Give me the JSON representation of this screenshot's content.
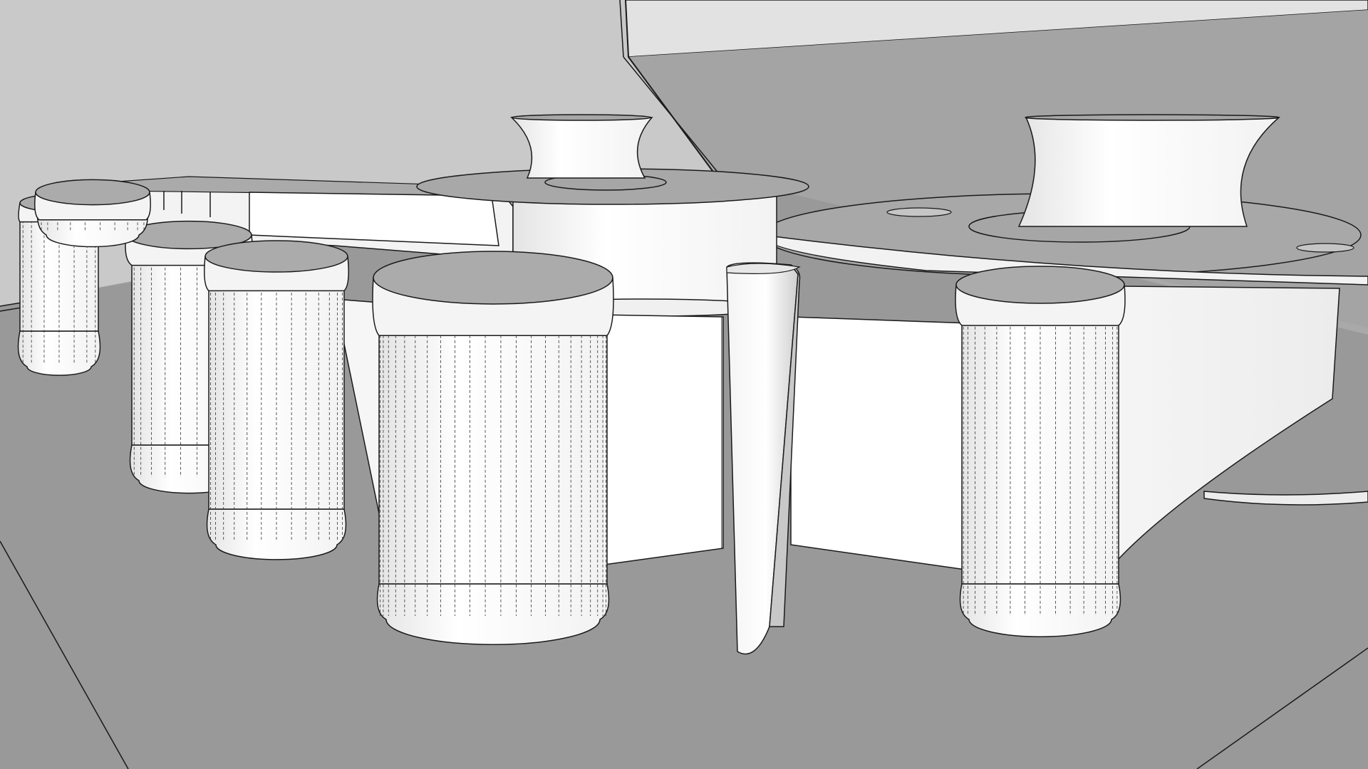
{
  "viewport": {
    "description_hidden": true,
    "style": "hidden-line",
    "edge_color": "#1a1a1a",
    "hidden_edge_color": "#333333",
    "face_color": "#ffffff",
    "shade_color": "#dcdcdc"
  },
  "colors": {
    "floor": "#999999",
    "left_wall": "#c8c8c8",
    "back_wall": "#a3a3a3",
    "ceiling": "#e2e2e2",
    "top_face": "#a6a6a6",
    "cap_face": "#ababab"
  },
  "objects": [
    {
      "id": "post-far-left",
      "kind": "column"
    },
    {
      "id": "post-left-2",
      "kind": "column"
    },
    {
      "id": "post-left-3",
      "kind": "column"
    },
    {
      "id": "post-left-4",
      "kind": "column"
    },
    {
      "id": "post-center",
      "kind": "column"
    },
    {
      "id": "post-right",
      "kind": "column"
    },
    {
      "id": "tower-center",
      "kind": "drum"
    },
    {
      "id": "funnel-center",
      "kind": "hourglass-cap"
    },
    {
      "id": "funnel-right",
      "kind": "hourglass-cap"
    },
    {
      "id": "disc-right",
      "kind": "platform"
    },
    {
      "id": "fin-center",
      "kind": "blade"
    }
  ]
}
